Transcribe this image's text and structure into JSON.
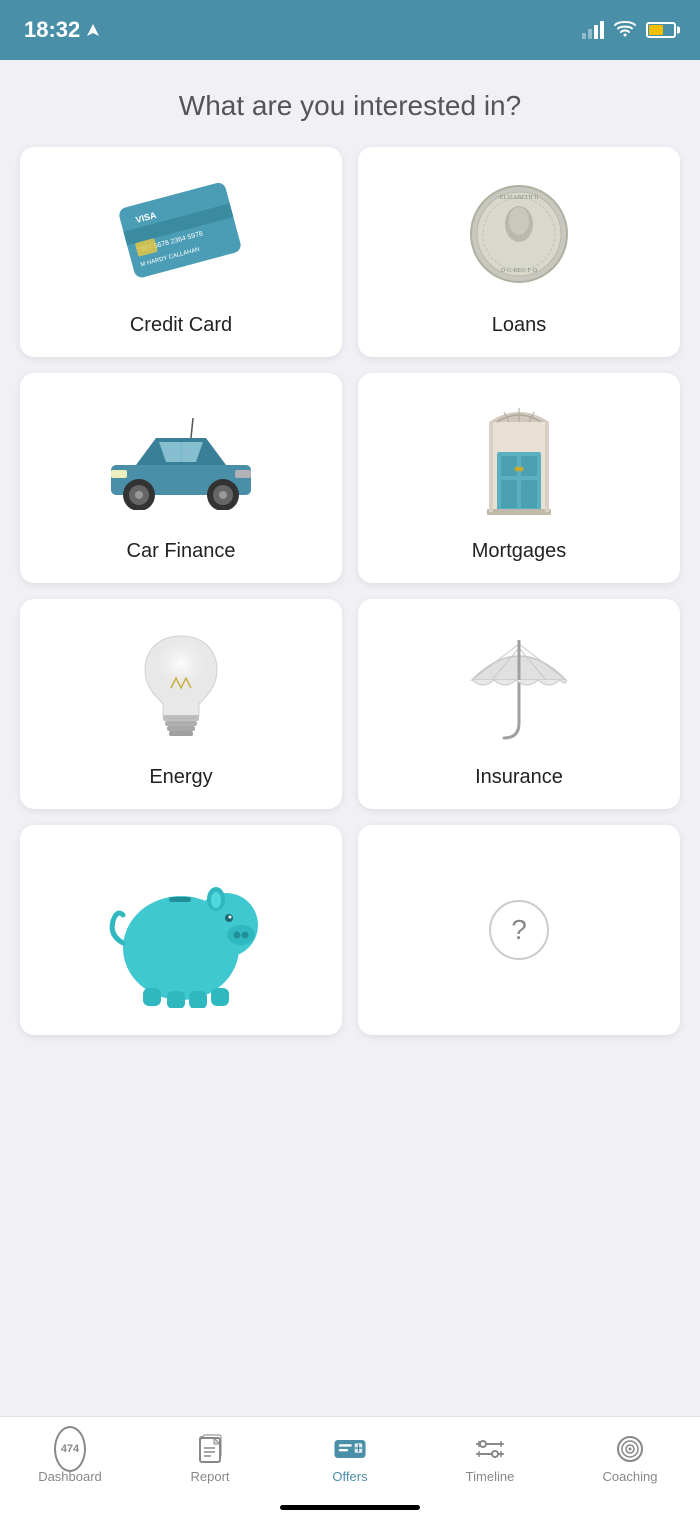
{
  "statusBar": {
    "time": "18:32",
    "locationIcon": "◁"
  },
  "page": {
    "title": "What are you interested in?"
  },
  "cards": [
    {
      "id": "credit-card",
      "label": "Credit Card",
      "type": "credit-card"
    },
    {
      "id": "loans",
      "label": "Loans",
      "type": "coin"
    },
    {
      "id": "car-finance",
      "label": "Car Finance",
      "type": "car"
    },
    {
      "id": "mortgages",
      "label": "Mortgages",
      "type": "door"
    },
    {
      "id": "energy",
      "label": "Energy",
      "type": "bulb"
    },
    {
      "id": "insurance",
      "label": "Insurance",
      "type": "umbrella"
    },
    {
      "id": "savings",
      "label": "",
      "type": "piggy"
    },
    {
      "id": "unknown",
      "label": "",
      "type": "question"
    }
  ],
  "bottomNav": {
    "items": [
      {
        "id": "dashboard",
        "label": "Dashboard",
        "badge": "474",
        "active": false
      },
      {
        "id": "report",
        "label": "Report",
        "active": false
      },
      {
        "id": "offers",
        "label": "Offers",
        "active": true
      },
      {
        "id": "timeline",
        "label": "Timeline",
        "active": false
      },
      {
        "id": "coaching",
        "label": "Coaching",
        "active": false
      }
    ]
  }
}
